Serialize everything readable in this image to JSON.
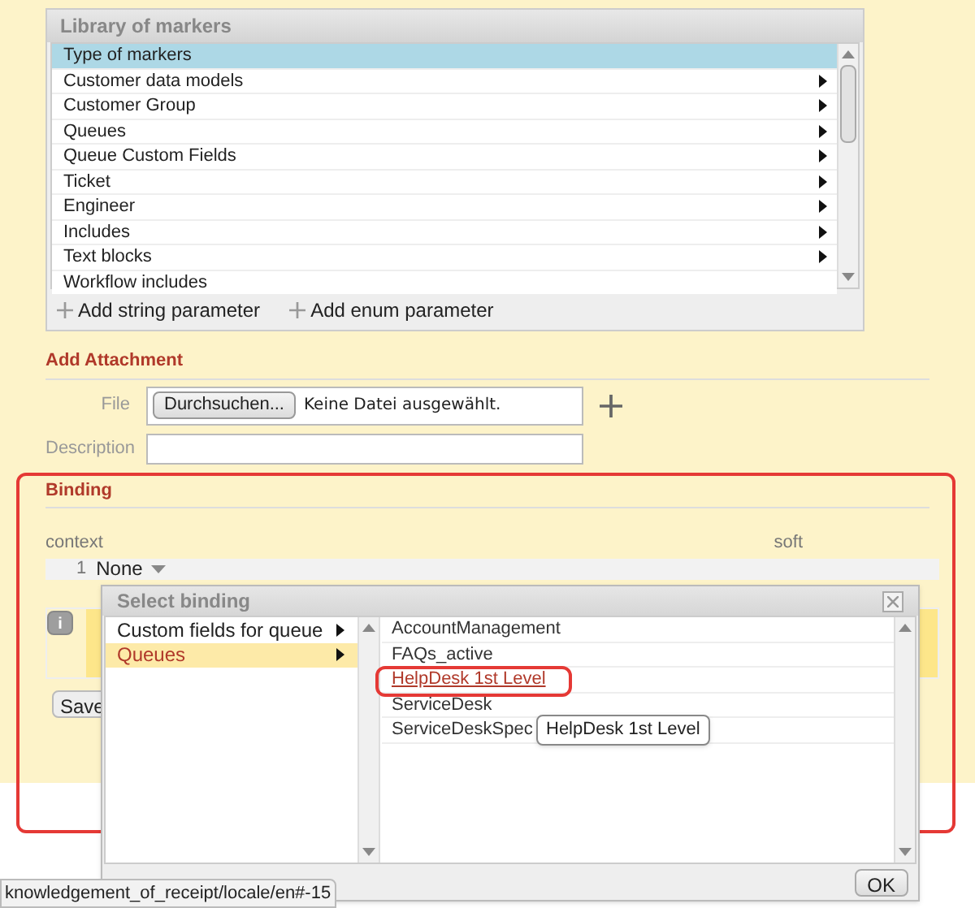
{
  "library": {
    "title": "Library of markers",
    "items": [
      {
        "label": "Type of markers",
        "selected": true,
        "has_submenu": false
      },
      {
        "label": "Customer data models",
        "selected": false,
        "has_submenu": true
      },
      {
        "label": "Customer Group",
        "selected": false,
        "has_submenu": true
      },
      {
        "label": "Queues",
        "selected": false,
        "has_submenu": true
      },
      {
        "label": "Queue Custom Fields",
        "selected": false,
        "has_submenu": true
      },
      {
        "label": "Ticket",
        "selected": false,
        "has_submenu": true
      },
      {
        "label": "Engineer",
        "selected": false,
        "has_submenu": true
      },
      {
        "label": "Includes",
        "selected": false,
        "has_submenu": true
      },
      {
        "label": "Text blocks",
        "selected": false,
        "has_submenu": true
      },
      {
        "label": "Workflow includes",
        "selected": false,
        "has_submenu": false
      }
    ],
    "actions": [
      "Add string parameter",
      "Add enum parameter"
    ]
  },
  "attachment": {
    "heading": "Add Attachment",
    "file_label": "File",
    "browse_button": "Durchsuchen...",
    "file_status": "Keine Datei ausgewählt.",
    "description_label": "Description"
  },
  "binding": {
    "heading": "Binding",
    "columns": [
      "context",
      "soft"
    ],
    "row": {
      "index": "1",
      "value": "None"
    },
    "info_button": "i",
    "save_button": "Save"
  },
  "dialog": {
    "title": "Select binding",
    "categories": [
      {
        "label": "Custom fields for queue",
        "selected": false
      },
      {
        "label": "Queues",
        "selected": true
      }
    ],
    "options": [
      {
        "label": "AccountManagement",
        "highlighted": false
      },
      {
        "label": "FAQs_active",
        "highlighted": false
      },
      {
        "label": "HelpDesk 1st Level",
        "highlighted": true
      },
      {
        "label": "ServiceDesk",
        "highlighted": false
      },
      {
        "label": "ServiceDeskSpec",
        "highlighted": false
      }
    ],
    "tooltip": "HelpDesk 1st Level",
    "ok_button": "OK"
  },
  "status_url": "knowledgement_of_receipt/locale/en#-15"
}
